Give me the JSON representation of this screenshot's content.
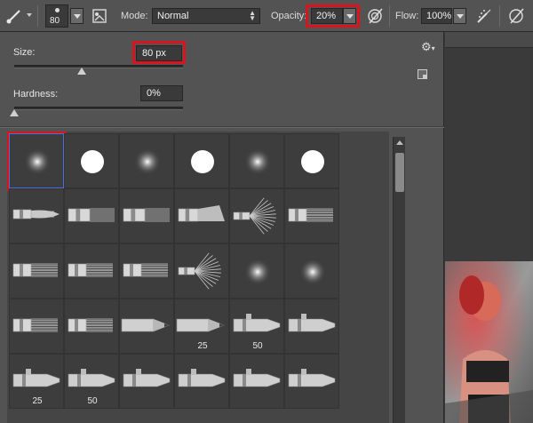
{
  "options_bar": {
    "brush_size_value": "80",
    "mode_label": "Mode:",
    "mode_value": "Normal",
    "opacity_label": "Opacity:",
    "opacity_value": "20%",
    "flow_label": "Flow:",
    "flow_value": "100%"
  },
  "brush_panel": {
    "size_label": "Size:",
    "size_value": "80 px",
    "size_slider_fraction": 0.4,
    "hardness_label": "Hardness:",
    "hardness_value": "0%",
    "hardness_slider_fraction": 0.0,
    "presets": [
      {
        "kind": "soft-round",
        "label": "",
        "selected": true
      },
      {
        "kind": "hard-round",
        "label": ""
      },
      {
        "kind": "soft-round",
        "label": ""
      },
      {
        "kind": "hard-round",
        "label": ""
      },
      {
        "kind": "soft-round",
        "label": ""
      },
      {
        "kind": "hard-round",
        "label": ""
      },
      {
        "kind": "round-point-brush",
        "label": ""
      },
      {
        "kind": "flat-banded-brush",
        "label": ""
      },
      {
        "kind": "flat-banded-brush",
        "label": ""
      },
      {
        "kind": "angled-brush",
        "label": ""
      },
      {
        "kind": "fan-brush",
        "label": ""
      },
      {
        "kind": "flat-bristle-brush",
        "label": ""
      },
      {
        "kind": "flat-bristle-brush",
        "label": ""
      },
      {
        "kind": "flat-bristle-brush",
        "label": ""
      },
      {
        "kind": "flat-bristle-brush",
        "label": ""
      },
      {
        "kind": "fan-brush",
        "label": ""
      },
      {
        "kind": "soft-round",
        "label": ""
      },
      {
        "kind": "soft-round",
        "label": ""
      },
      {
        "kind": "flat-bristle-brush",
        "label": ""
      },
      {
        "kind": "flat-bristle-brush",
        "label": ""
      },
      {
        "kind": "pencil",
        "label": ""
      },
      {
        "kind": "pencil",
        "label": "25"
      },
      {
        "kind": "airbrush-pen",
        "label": "50"
      },
      {
        "kind": "airbrush-pen",
        "label": ""
      },
      {
        "kind": "airbrush-pen",
        "label": "25"
      },
      {
        "kind": "airbrush-pen",
        "label": "50"
      },
      {
        "kind": "airbrush-pen",
        "label": ""
      },
      {
        "kind": "airbrush-pen",
        "label": ""
      },
      {
        "kind": "airbrush-pen",
        "label": ""
      },
      {
        "kind": "airbrush-pen",
        "label": ""
      }
    ]
  },
  "colors": {
    "highlight_red": "#d8141e",
    "panel_bg": "#535353",
    "field_bg": "#3a3a3a",
    "selected_cell_border": "#4a6fd8"
  },
  "icons": {
    "brush_tool": "brush-icon",
    "brush_dropdown": "chevron-down-icon",
    "toggle_brush_panel": "brush-panel-icon",
    "pressure_opacity": "pressure-opacity-icon",
    "airbrush": "airbrush-icon",
    "pressure_size": "pressure-size-icon",
    "panel_settings": "gear-icon",
    "new_preset": "new-preset-icon"
  }
}
